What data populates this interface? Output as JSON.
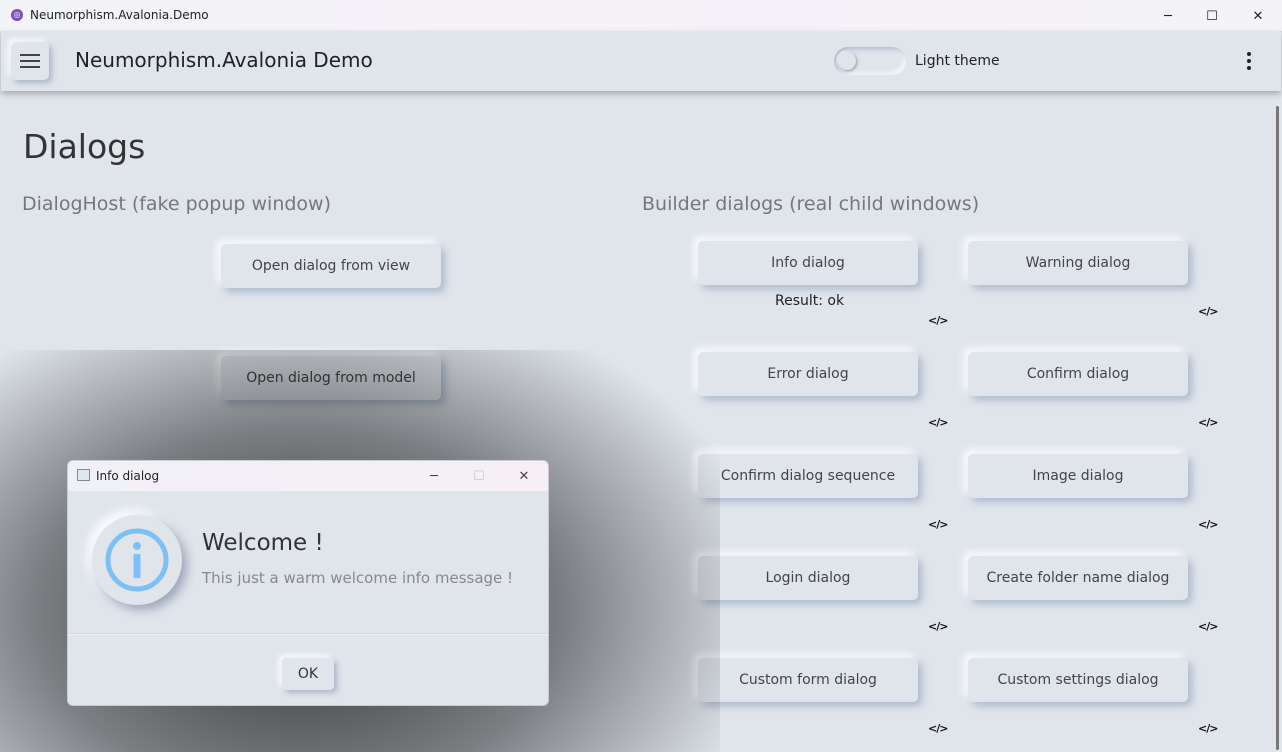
{
  "window": {
    "title": "Neumorphism.Avalonia.Demo",
    "app_icon_glyph": "◎",
    "minimize_glyph": "─",
    "maximize_glyph": "☐",
    "close_glyph": "✕"
  },
  "appbar": {
    "title": "Neumorphism.Avalonia Demo",
    "theme_toggle": {
      "label": "Light theme",
      "checked": false
    },
    "menu_icon": "hamburger-menu-icon",
    "more_icon": "more-vertical-icon"
  },
  "page": {
    "title": "Dialogs",
    "left_section": {
      "heading": "DialogHost (fake popup window)",
      "buttons": [
        "Open dialog from view",
        "Open dialog from model"
      ]
    },
    "right_section": {
      "heading": "Builder dialogs (real child windows)",
      "result_text": "Result: ok",
      "code_glyph": "</>",
      "buttons": [
        "Info dialog",
        "Warning dialog",
        "Error dialog",
        "Confirm dialog",
        "Confirm dialog sequence",
        "Image dialog",
        "Login dialog",
        "Create folder name dialog",
        "Custom form dialog",
        "Custom settings dialog"
      ]
    }
  },
  "dialog": {
    "window_title": "Info dialog",
    "heading": "Welcome !",
    "message": "This just a warm welcome info message !",
    "ok_label": "OK",
    "icon": "info-icon",
    "accent_color": "#7ec0f4"
  }
}
